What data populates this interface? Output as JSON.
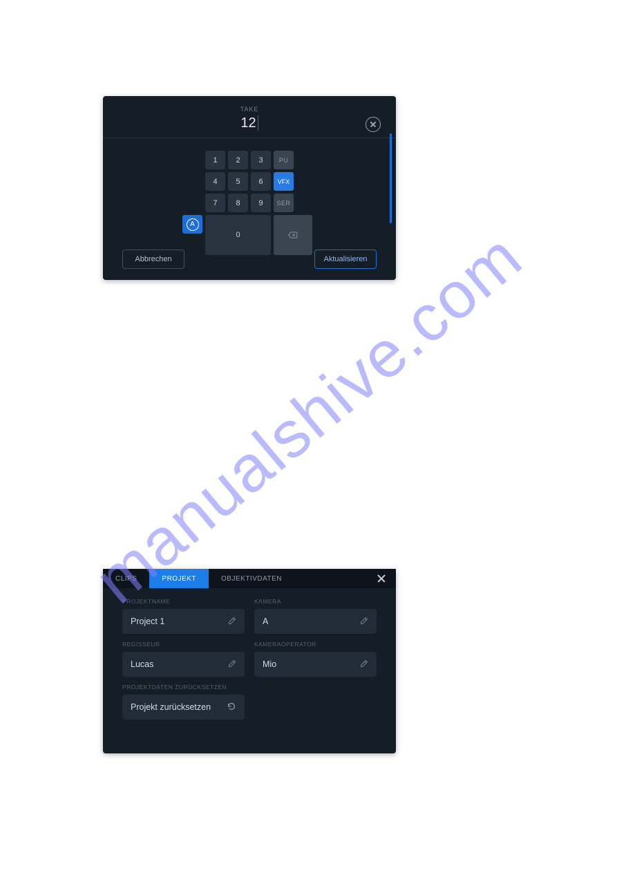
{
  "watermark": "manualshive.com",
  "take_panel": {
    "label": "TAKE",
    "value": "12",
    "keypad": {
      "row1": [
        "1",
        "2",
        "3",
        "PU"
      ],
      "row2": [
        "4",
        "5",
        "6",
        "VFX"
      ],
      "row3": [
        "7",
        "8",
        "9",
        "SER"
      ],
      "a_key": "A",
      "zero": "0"
    },
    "cancel_label": "Abbrechen",
    "update_label": "Aktualisieren"
  },
  "project_panel": {
    "tabs": {
      "clips": "CLIPS",
      "projekt": "PROJEKT",
      "objektiv": "OBJEKTIVDATEN"
    },
    "fields": {
      "projectname_label": "PROJEKTNAME",
      "projectname_value": "Project 1",
      "camera_label": "KAMERA",
      "camera_value": "A",
      "director_label": "REGISSEUR",
      "director_value": "Lucas",
      "operator_label": "KAMERAOPERATOR",
      "operator_value": "Mio",
      "reset_label": "PROJEKTDATEN ZURÜCKSETZEN",
      "reset_value": "Projekt zurücksetzen"
    }
  }
}
